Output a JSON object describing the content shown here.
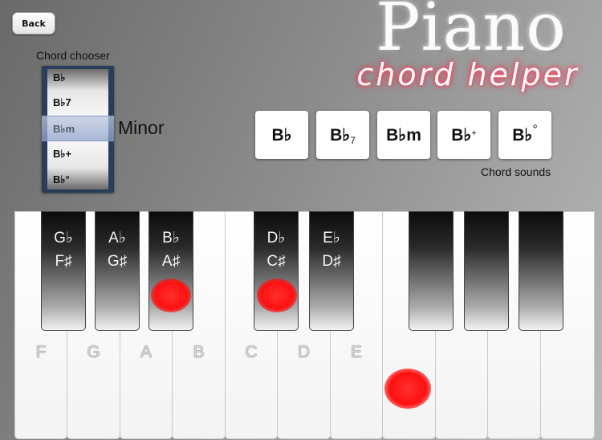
{
  "header": {
    "back_label": "Back",
    "title_main": "Piano",
    "title_sub": "chord helper"
  },
  "chooser": {
    "label": "Chord chooser",
    "rows": [
      "B♭",
      "B♭7",
      "B♭m",
      "B♭+",
      "B♭°"
    ],
    "selected": "B♭m",
    "quality": "Minor"
  },
  "chord_buttons": [
    {
      "root": "B♭",
      "suffix": ""
    },
    {
      "root": "B♭",
      "suffix": "7"
    },
    {
      "root": "B♭m",
      "suffix": ""
    },
    {
      "root": "B♭",
      "suffix": "+"
    },
    {
      "root": "B♭",
      "suffix": "°"
    }
  ],
  "sounds_label": "Chord sounds",
  "keyboard": {
    "white_keys": [
      "F",
      "G",
      "A",
      "B",
      "C",
      "D",
      "E",
      "",
      "",
      "",
      ""
    ],
    "black_keys": [
      {
        "top": "G♭",
        "bottom": "F♯"
      },
      {
        "top": "A♭",
        "bottom": "G♯"
      },
      {
        "top": "B♭",
        "bottom": "A♯"
      },
      {
        "top": "D♭",
        "bottom": "C♯"
      },
      {
        "top": "E♭",
        "bottom": "D♯"
      },
      {
        "top": "",
        "bottom": ""
      },
      {
        "top": "",
        "bottom": ""
      },
      {
        "top": "",
        "bottom": ""
      }
    ],
    "highlighted_notes": [
      "B♭",
      "D♭",
      "F"
    ]
  },
  "colors": {
    "highlight": "#ff1a1a",
    "title_glow": "#ff2040"
  }
}
